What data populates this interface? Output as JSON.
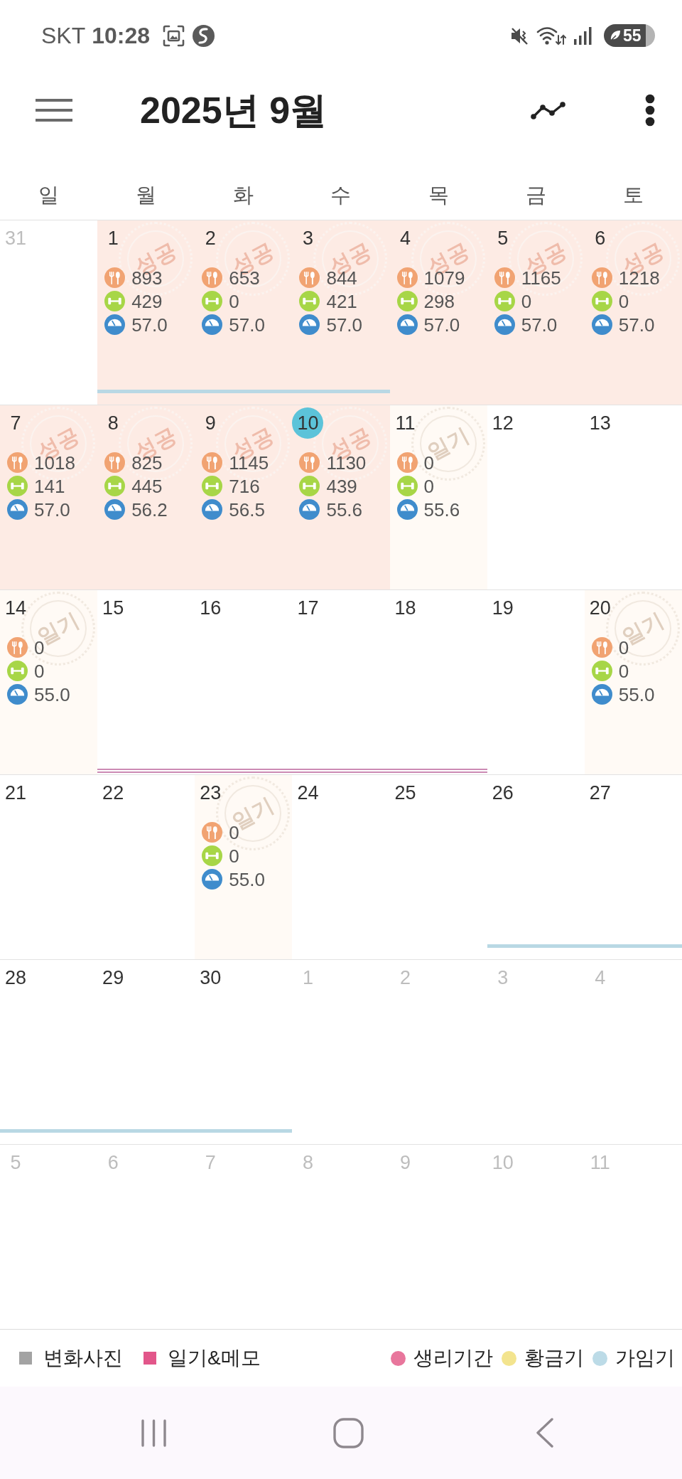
{
  "status_bar": {
    "carrier": "SKT",
    "time": "10:28",
    "battery": "55"
  },
  "header": {
    "title": "2025년 9월"
  },
  "weekdays": [
    "일",
    "월",
    "화",
    "수",
    "목",
    "금",
    "토"
  ],
  "weeks": [
    {
      "days": [
        {
          "label": "31",
          "kind": "plain",
          "other_month": true,
          "today": false,
          "fertile": false,
          "period": false
        },
        {
          "label": "1",
          "kind": "success",
          "other_month": false,
          "today": false,
          "fertile": true,
          "period": false,
          "stamp": "성공",
          "metrics": [
            {
              "kind": "meal",
              "value": "893"
            },
            {
              "kind": "exercise",
              "value": "429"
            },
            {
              "kind": "weight",
              "value": "57.0"
            }
          ]
        },
        {
          "label": "2",
          "kind": "success",
          "other_month": false,
          "today": false,
          "fertile": true,
          "period": false,
          "stamp": "성공",
          "metrics": [
            {
              "kind": "meal",
              "value": "653"
            },
            {
              "kind": "exercise",
              "value": "0"
            },
            {
              "kind": "weight",
              "value": "57.0"
            }
          ]
        },
        {
          "label": "3",
          "kind": "success",
          "other_month": false,
          "today": false,
          "fertile": true,
          "period": false,
          "stamp": "성공",
          "metrics": [
            {
              "kind": "meal",
              "value": "844"
            },
            {
              "kind": "exercise",
              "value": "421"
            },
            {
              "kind": "weight",
              "value": "57.0"
            }
          ]
        },
        {
          "label": "4",
          "kind": "success",
          "other_month": false,
          "today": false,
          "fertile": false,
          "period": false,
          "stamp": "성공",
          "metrics": [
            {
              "kind": "meal",
              "value": "1079"
            },
            {
              "kind": "exercise",
              "value": "298"
            },
            {
              "kind": "weight",
              "value": "57.0"
            }
          ]
        },
        {
          "label": "5",
          "kind": "success",
          "other_month": false,
          "today": false,
          "fertile": false,
          "period": false,
          "stamp": "성공",
          "metrics": [
            {
              "kind": "meal",
              "value": "1165"
            },
            {
              "kind": "exercise",
              "value": "0"
            },
            {
              "kind": "weight",
              "value": "57.0"
            }
          ]
        },
        {
          "label": "6",
          "kind": "success",
          "other_month": false,
          "today": false,
          "fertile": false,
          "period": false,
          "stamp": "성공",
          "metrics": [
            {
              "kind": "meal",
              "value": "1218"
            },
            {
              "kind": "exercise",
              "value": "0"
            },
            {
              "kind": "weight",
              "value": "57.0"
            }
          ]
        }
      ]
    },
    {
      "days": [
        {
          "label": "7",
          "kind": "success",
          "other_month": false,
          "today": false,
          "fertile": false,
          "period": false,
          "stamp": "성공",
          "metrics": [
            {
              "kind": "meal",
              "value": "1018"
            },
            {
              "kind": "exercise",
              "value": "141"
            },
            {
              "kind": "weight",
              "value": "57.0"
            }
          ]
        },
        {
          "label": "8",
          "kind": "success",
          "other_month": false,
          "today": false,
          "fertile": false,
          "period": false,
          "stamp": "성공",
          "metrics": [
            {
              "kind": "meal",
              "value": "825"
            },
            {
              "kind": "exercise",
              "value": "445"
            },
            {
              "kind": "weight",
              "value": "56.2"
            }
          ]
        },
        {
          "label": "9",
          "kind": "success",
          "other_month": false,
          "today": false,
          "fertile": false,
          "period": false,
          "stamp": "성공",
          "metrics": [
            {
              "kind": "meal",
              "value": "1145"
            },
            {
              "kind": "exercise",
              "value": "716"
            },
            {
              "kind": "weight",
              "value": "56.5"
            }
          ]
        },
        {
          "label": "10",
          "kind": "success",
          "other_month": false,
          "today": true,
          "fertile": false,
          "period": false,
          "stamp": "성공",
          "metrics": [
            {
              "kind": "meal",
              "value": "1130"
            },
            {
              "kind": "exercise",
              "value": "439"
            },
            {
              "kind": "weight",
              "value": "55.6"
            }
          ]
        },
        {
          "label": "11",
          "kind": "diary",
          "other_month": false,
          "today": false,
          "fertile": false,
          "period": false,
          "stamp": "일기",
          "metrics": [
            {
              "kind": "meal",
              "value": "0"
            },
            {
              "kind": "exercise",
              "value": "0"
            },
            {
              "kind": "weight",
              "value": "55.6"
            }
          ]
        },
        {
          "label": "12",
          "kind": "plain",
          "other_month": false,
          "today": false,
          "fertile": false,
          "period": false
        },
        {
          "label": "13",
          "kind": "plain",
          "other_month": false,
          "today": false,
          "fertile": false,
          "period": false
        }
      ]
    },
    {
      "days": [
        {
          "label": "14",
          "kind": "diary",
          "other_month": false,
          "today": false,
          "fertile": false,
          "period": false,
          "stamp": "일기",
          "metrics": [
            {
              "kind": "meal",
              "value": "0"
            },
            {
              "kind": "exercise",
              "value": "0"
            },
            {
              "kind": "weight",
              "value": "55.0"
            }
          ]
        },
        {
          "label": "15",
          "kind": "plain",
          "other_month": false,
          "today": false,
          "fertile": false,
          "period": true
        },
        {
          "label": "16",
          "kind": "plain",
          "other_month": false,
          "today": false,
          "fertile": false,
          "period": true
        },
        {
          "label": "17",
          "kind": "plain",
          "other_month": false,
          "today": false,
          "fertile": false,
          "period": true
        },
        {
          "label": "18",
          "kind": "plain",
          "other_month": false,
          "today": false,
          "fertile": false,
          "period": true
        },
        {
          "label": "19",
          "kind": "plain",
          "other_month": false,
          "today": false,
          "fertile": false,
          "period": false
        },
        {
          "label": "20",
          "kind": "diary",
          "other_month": false,
          "today": false,
          "fertile": false,
          "period": false,
          "stamp": "일기",
          "metrics": [
            {
              "kind": "meal",
              "value": "0"
            },
            {
              "kind": "exercise",
              "value": "0"
            },
            {
              "kind": "weight",
              "value": "55.0"
            }
          ]
        }
      ]
    },
    {
      "days": [
        {
          "label": "21",
          "kind": "plain",
          "other_month": false,
          "today": false,
          "fertile": false,
          "period": false
        },
        {
          "label": "22",
          "kind": "plain",
          "other_month": false,
          "today": false,
          "fertile": false,
          "period": false
        },
        {
          "label": "23",
          "kind": "diary",
          "other_month": false,
          "today": false,
          "fertile": false,
          "period": false,
          "stamp": "일기",
          "metrics": [
            {
              "kind": "meal",
              "value": "0"
            },
            {
              "kind": "exercise",
              "value": "0"
            },
            {
              "kind": "weight",
              "value": "55.0"
            }
          ]
        },
        {
          "label": "24",
          "kind": "plain",
          "other_month": false,
          "today": false,
          "fertile": false,
          "period": false
        },
        {
          "label": "25",
          "kind": "plain",
          "other_month": false,
          "today": false,
          "fertile": false,
          "period": false
        },
        {
          "label": "26",
          "kind": "plain",
          "other_month": false,
          "today": false,
          "fertile": true,
          "period": false
        },
        {
          "label": "27",
          "kind": "plain",
          "other_month": false,
          "today": false,
          "fertile": true,
          "period": false
        }
      ]
    },
    {
      "days": [
        {
          "label": "28",
          "kind": "plain",
          "other_month": false,
          "today": false,
          "fertile": true,
          "period": false
        },
        {
          "label": "29",
          "kind": "plain",
          "other_month": false,
          "today": false,
          "fertile": true,
          "period": false
        },
        {
          "label": "30",
          "kind": "plain",
          "other_month": false,
          "today": false,
          "fertile": true,
          "period": false
        },
        {
          "label": "1",
          "kind": "plain",
          "other_month": true,
          "today": false,
          "fertile": false,
          "period": false
        },
        {
          "label": "2",
          "kind": "plain",
          "other_month": true,
          "today": false,
          "fertile": false,
          "period": false
        },
        {
          "label": "3",
          "kind": "plain",
          "other_month": true,
          "today": false,
          "fertile": false,
          "period": false
        },
        {
          "label": "4",
          "kind": "plain",
          "other_month": true,
          "today": false,
          "fertile": false,
          "period": false
        }
      ]
    },
    {
      "days": [
        {
          "label": "5",
          "kind": "plain",
          "other_month": true,
          "today": false,
          "fertile": false,
          "period": false
        },
        {
          "label": "6",
          "kind": "plain",
          "other_month": true,
          "today": false,
          "fertile": false,
          "period": false
        },
        {
          "label": "7",
          "kind": "plain",
          "other_month": true,
          "today": false,
          "fertile": false,
          "period": false
        },
        {
          "label": "8",
          "kind": "plain",
          "other_month": true,
          "today": false,
          "fertile": false,
          "period": false
        },
        {
          "label": "9",
          "kind": "plain",
          "other_month": true,
          "today": false,
          "fertile": false,
          "period": false
        },
        {
          "label": "10",
          "kind": "plain",
          "other_month": true,
          "today": false,
          "fertile": false,
          "period": false
        },
        {
          "label": "11",
          "kind": "plain",
          "other_month": true,
          "today": false,
          "fertile": false,
          "period": false
        }
      ]
    }
  ],
  "legend": {
    "markers": [
      {
        "label": "변화사진",
        "color": "#a3a3a3"
      },
      {
        "label": "일기&메모",
        "color": "#e2568a"
      }
    ],
    "phases": [
      {
        "label": "생리기간",
        "color": "#e8769c"
      },
      {
        "label": "황금기",
        "color": "#f3e48e"
      },
      {
        "label": "가임기",
        "color": "#bcdbe7"
      }
    ]
  }
}
